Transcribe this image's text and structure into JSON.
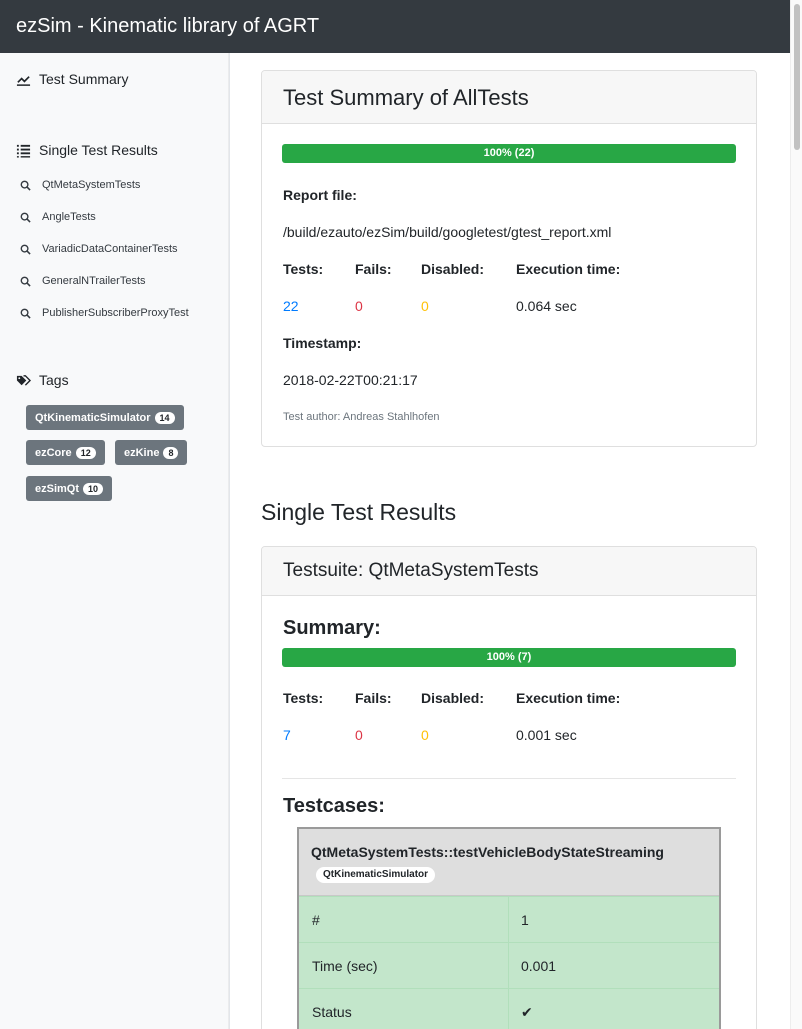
{
  "app": {
    "title": "ezSim - Kinematic library of AGRT"
  },
  "sidebar": {
    "summary_label": "Test Summary",
    "single_results_label": "Single Test Results",
    "tests": [
      "QtMetaSystemTests",
      "AngleTests",
      "VariadicDataContainerTests",
      "GeneralNTrailerTests",
      "PublisherSubscriberProxyTest"
    ],
    "tags_label": "Tags",
    "tags": [
      {
        "name": "QtKinematicSimulator",
        "count": "14"
      },
      {
        "name": "ezCore",
        "count": "12"
      },
      {
        "name": "ezKine",
        "count": "8"
      },
      {
        "name": "ezSimQt",
        "count": "10"
      }
    ]
  },
  "summary_card": {
    "title": "Test Summary of AllTests",
    "progress_label": "100% (22)",
    "progress_fraction": 1.0,
    "report_file_label": "Report file:",
    "report_file": "/build/ezauto/ezSim/build/googletest/gtest_report.xml",
    "tests_label": "Tests:",
    "fails_label": "Fails:",
    "disabled_label": "Disabled:",
    "exec_label": "Execution time:",
    "tests": "22",
    "fails": "0",
    "disabled": "0",
    "exec_time": "0.064 sec",
    "timestamp_label": "Timestamp:",
    "timestamp": "2018-02-22T00:21:17",
    "author": "Test author: Andreas Stahlhofen"
  },
  "single_results_title": "Single Test Results",
  "suite_card": {
    "title": "Testsuite: QtMetaSystemTests",
    "summary_label": "Summary:",
    "progress_label": "100% (7)",
    "progress_fraction": 1.0,
    "tests_label": "Tests:",
    "fails_label": "Fails:",
    "disabled_label": "Disabled:",
    "exec_label": "Execution time:",
    "tests": "7",
    "fails": "0",
    "disabled": "0",
    "exec_time": "0.001 sec",
    "testcases_label": "Testcases:",
    "testcase": {
      "name": "QtMetaSystemTests::testVehicleBodyStateStreaming",
      "tag": "QtKinematicSimulator",
      "rows": [
        {
          "key": "#",
          "value": "1"
        },
        {
          "key": "Time (sec)",
          "value": "0.001"
        },
        {
          "key": "Status",
          "value": "✔"
        }
      ]
    }
  },
  "colors": {
    "success": "#28a745",
    "topbar": "#343a40",
    "tag": "#6c757d",
    "pass_row": "#c3e6cb"
  }
}
